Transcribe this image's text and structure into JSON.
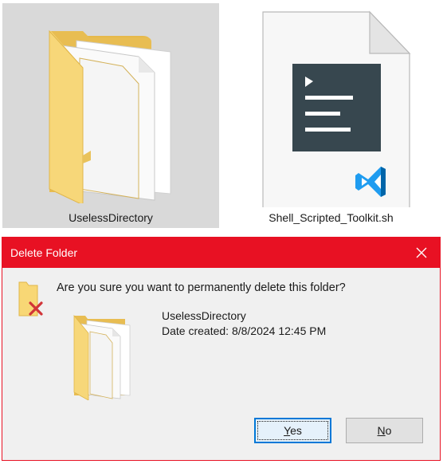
{
  "desktop": {
    "folder_tile": {
      "label": "UselessDirectory",
      "selected": true,
      "icon": "folder-with-documents-icon"
    },
    "script_tile": {
      "label": "Shell_Scripted_Toolkit.sh",
      "icon": "vscode-shell-script-file-icon"
    }
  },
  "dialog": {
    "title": "Delete Folder",
    "question": "Are you sure you want to permanently delete this folder?",
    "item_name": "UselessDirectory",
    "item_date": "Date created: 8/8/2024 12:45 PM",
    "yes_button": {
      "mnemonic": "Y",
      "rest": "es"
    },
    "no_button": {
      "mnemonic": "N",
      "rest": "o"
    },
    "colors": {
      "titlebar": "#e81123",
      "body": "#f0f0f0",
      "default_button_border": "#0078d7",
      "folder_yellow": "#f8d775",
      "delete_x": "#d13438"
    }
  }
}
